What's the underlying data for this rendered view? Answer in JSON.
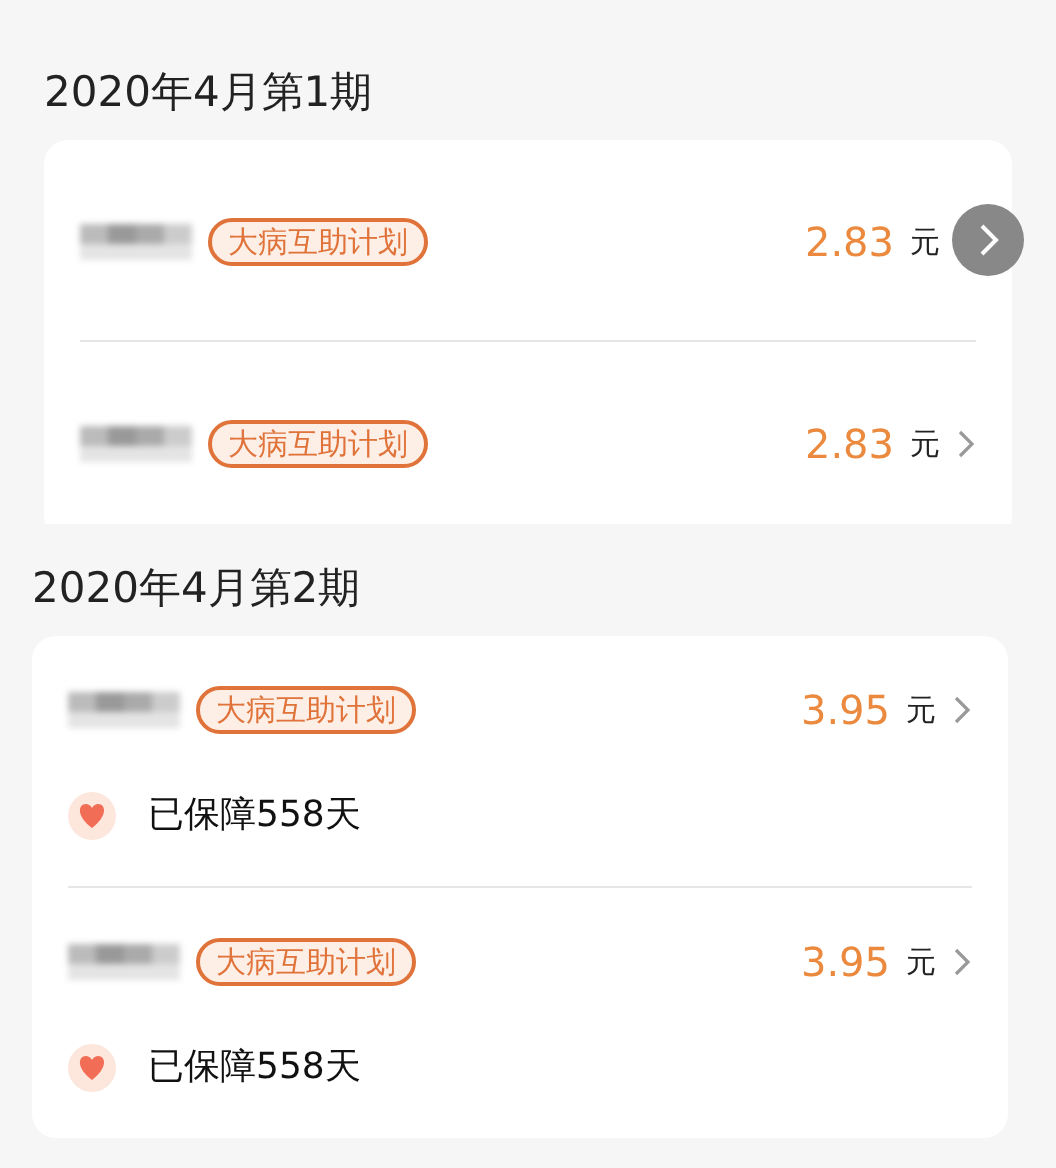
{
  "periods": [
    {
      "title": "2020年4月第1期",
      "items": [
        {
          "tag": "大病互助计划",
          "amount": "2.83",
          "unit": "元",
          "overlay_button": true
        },
        {
          "tag": "大病互助计划",
          "amount": "2.83",
          "unit": "元",
          "overlay_button": false
        }
      ]
    },
    {
      "title": "2020年4月第2期",
      "items": [
        {
          "tag": "大病互助计划",
          "amount": "3.95",
          "unit": "元",
          "overlay_button": false,
          "coverage": "已保障558天"
        },
        {
          "tag": "大病互助计划",
          "amount": "3.95",
          "unit": "元",
          "overlay_button": false,
          "coverage": "已保障558天"
        }
      ]
    }
  ]
}
